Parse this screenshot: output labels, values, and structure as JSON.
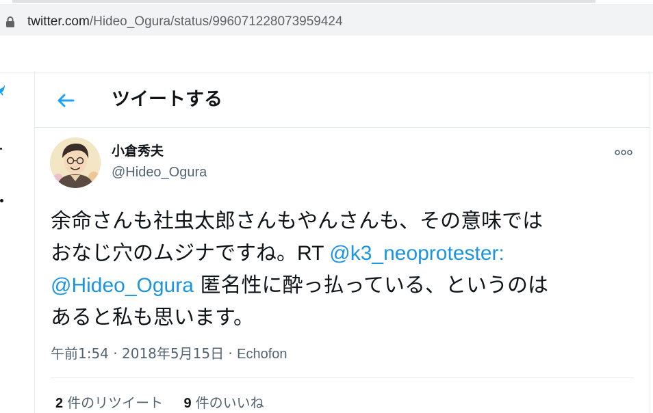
{
  "browser": {
    "url_host": "twitter.com",
    "url_path": "/Hideo_Ogura/status/996071228073959424"
  },
  "header": {
    "title": "ツイートする"
  },
  "tweet": {
    "author_name": "小倉秀夫",
    "author_handle": "@Hideo_Ogura",
    "text": {
      "line1": "余命さんも社虫太郎さんもやんさんも、その意味では",
      "line2_a": "おなじ穴のムジナですね。",
      "line2_rt": "RT ",
      "line2_mention": "@k3_neoprotester",
      "line2_colon": ":",
      "line3_mention": "@Hideo_Ogura",
      "line3_b": " 匿名性に酔っ払っている、というのは",
      "line4": "あると私も思います。"
    },
    "time": "午前1:54",
    "sep1": " · ",
    "date": "2018年5月15日",
    "sep2": " · ",
    "source": "Echofon",
    "retweet_count": "2",
    "retweet_label": "件のリツイート",
    "like_count": "9",
    "like_label": "件のいいね"
  },
  "colors": {
    "accent": "#1b95e0",
    "text": "#0f1419",
    "muted": "#536471",
    "border": "#e6ecf0"
  },
  "icons": [
    "lock-icon",
    "twitter-bird-icon",
    "back-arrow-icon",
    "more-options-icon"
  ]
}
